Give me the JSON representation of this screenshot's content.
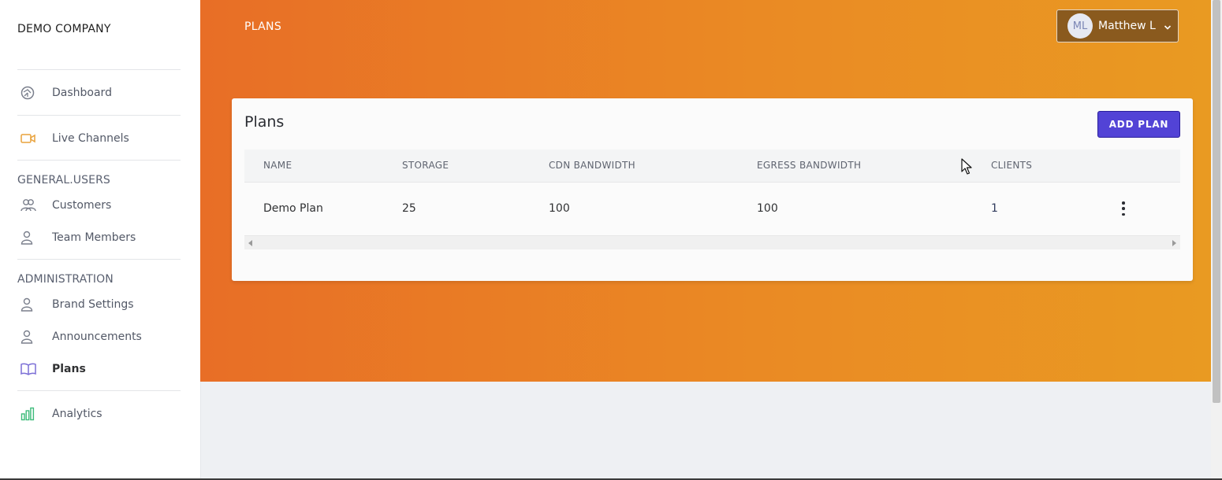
{
  "sidebar": {
    "brand": "DEMO COMPANY",
    "items_top": [
      {
        "label": "Dashboard",
        "icon": "dashboard-icon"
      },
      {
        "label": "Live Channels",
        "icon": "video-camera-icon"
      }
    ],
    "section_users": "GENERAL.USERS",
    "items_users": [
      {
        "label": "Customers",
        "icon": "users-icon"
      },
      {
        "label": "Team Members",
        "icon": "user-icon"
      }
    ],
    "section_admin": "ADMINISTRATION",
    "items_admin": [
      {
        "label": "Brand Settings",
        "icon": "user-icon"
      },
      {
        "label": "Announcements",
        "icon": "user-icon"
      },
      {
        "label": "Plans",
        "icon": "book-icon",
        "active": true
      }
    ],
    "items_bottom": [
      {
        "label": "Analytics",
        "icon": "bar-chart-icon"
      }
    ]
  },
  "header": {
    "page_label": "PLANS",
    "user": {
      "initials": "ML",
      "name": "Matthew L"
    }
  },
  "card": {
    "title": "Plans",
    "add_button": "ADD PLAN",
    "columns": [
      "NAME",
      "STORAGE",
      "CDN BANDWIDTH",
      "EGRESS BANDWIDTH",
      "CLIENTS"
    ],
    "rows": [
      {
        "name": "Demo Plan",
        "storage": "25",
        "cdn_bandwidth": "100",
        "egress_bandwidth": "100",
        "clients": "1"
      }
    ]
  },
  "colors": {
    "accent_button": "#5243d6",
    "hero_gradient_start": "#e86e26",
    "hero_gradient_end": "#e99a22",
    "active_icon": "#7b6fd6",
    "live_icon": "#e9a23b",
    "analytics_icon": "#3dbb7a"
  }
}
